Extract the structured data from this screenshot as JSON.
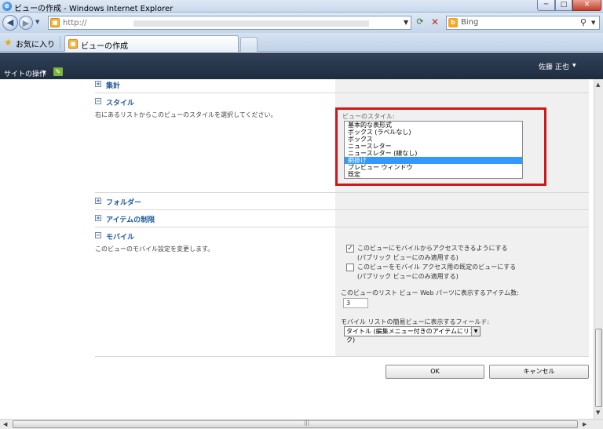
{
  "window": {
    "title": "ビューの作成 - Windows Internet Explorer",
    "min": "─",
    "max": "□",
    "close": "✕"
  },
  "address": {
    "url": "http://",
    "search_provider": "Bing"
  },
  "favorites": {
    "label": "お気に入り"
  },
  "tab": {
    "label": "ビューの作成"
  },
  "sharepoint": {
    "site_actions": "サイトの操作",
    "user": "佐藤 正也"
  },
  "sections": {
    "totals": "集計",
    "style": "スタイル",
    "style_desc": "右にあるリストからこのビューのスタイルを選択してください。",
    "folders": "フォルダー",
    "item_limit": "アイテムの制限",
    "mobile": "モバイル",
    "mobile_desc": "このビューのモバイル設定を変更します。"
  },
  "style_list": {
    "label": "ビューのスタイル:",
    "items": [
      "基本的な表形式",
      "ボックス (ラベルなし)",
      "ボックス",
      "ニュースレター",
      "ニュースレター (線なし)",
      "網掛け",
      "プレビュー ウィンドウ",
      "既定"
    ],
    "selected": "網掛け"
  },
  "mobile": {
    "check1_line1": "このビューにモバイルからアクセスできるようにする",
    "check1_line2": "(パブリック ビューにのみ適用する)",
    "check1_checked": true,
    "check2_line1": "このビューをモバイル アクセス用の既定のビューにする",
    "check2_line2": "(パブリック ビューにのみ適用する)",
    "check2_checked": false,
    "item_count_label": "このビューのリスト ビュー Web パーツに表示するアイテム数:",
    "item_count_value": "3",
    "field_label": "モバイル リストの簡易ビューに表示するフィールド:",
    "field_value": "タイトル (編集メニュー付きのアイテムにリンク)"
  },
  "buttons": {
    "ok": "OK",
    "cancel": "キャンセル"
  },
  "colors": {
    "highlight": "#d0161d",
    "selection": "#3399ff",
    "header": "#1e2c3e",
    "link": "#1f5b98"
  }
}
